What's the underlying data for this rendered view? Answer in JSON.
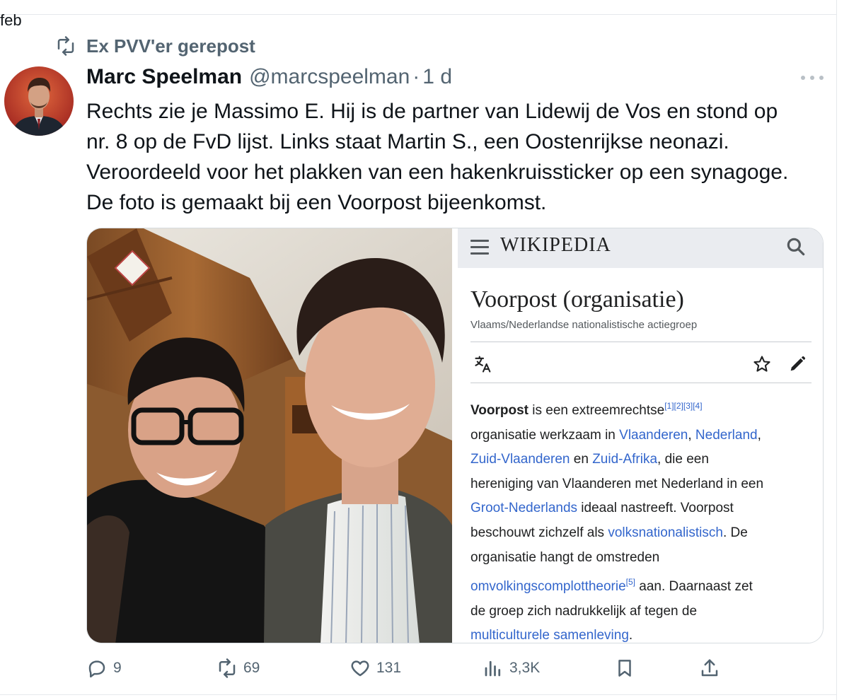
{
  "prev_fragment": "feb",
  "repost": {
    "label": "Ex PVV'er gerepost",
    "icon": "repost-icon"
  },
  "tweet": {
    "display_name": "Marc Speelman",
    "handle": "@marcspeelman",
    "separator": "·",
    "time": "1 d",
    "text_lines": [
      "Rechts zie je Massimo E. Hij is de partner van Lidewij de Vos en stond op",
      "nr. 8 op de FvD lijst. Links staat Martin S., een Oostenrijkse neonazi.",
      "Veroordeeld voor het plakken van een hakenkruissticker op een synagoge.",
      "De foto is gemaakt bij een Voorpost bijeenkomst."
    ]
  },
  "wiki": {
    "logo": "WIKIPEDIA",
    "title": "Voorpost (organisatie)",
    "subtitle": "Vlaams/Nederlandse nationalistische actiegroep",
    "p_term": "Voorpost",
    "p_l1a": " is een extreemrechtse",
    "refs1": "[1][2][3][4]",
    "p_l2a": "organisatie werkzaam in ",
    "link_vlaanderen": "Vlaanderen",
    "comma1": ", ",
    "link_nederland": "Nederland",
    "comma2": ",",
    "link_zuidvlaanderen": "Zuid-Vlaanderen",
    "p_en": " en ",
    "link_zuidafrika": "Zuid-Afrika",
    "p_l3b": ", die een",
    "p_l4": "hereniging van Vlaanderen met Nederland in een",
    "link_grootnederlands": "Groot-Nederlands",
    "p_l5b": " ideaal nastreeft. Voorpost",
    "p_l6a": "beschouwt zichzelf als ",
    "link_volks": "volksnationalistisch",
    "p_l6b": ". De",
    "p_l7": "organisatie hangt de omstreden",
    "link_omvolking": "omvolkingscomplottheorie",
    "refs2": "[5]",
    "p_l8b": " aan. Daarnaast zet",
    "p_l9": "de groep zich nadrukkelijk af tegen de",
    "link_multicult": "multiculturele samenleving",
    "p_end": "."
  },
  "actions": {
    "replies": "9",
    "reposts": "69",
    "likes": "131",
    "views": "3,3K"
  },
  "colors": {
    "text": "#0f1419",
    "secondary": "#536471",
    "wiki_link": "#3366cc",
    "border": "#e6e9ec"
  }
}
